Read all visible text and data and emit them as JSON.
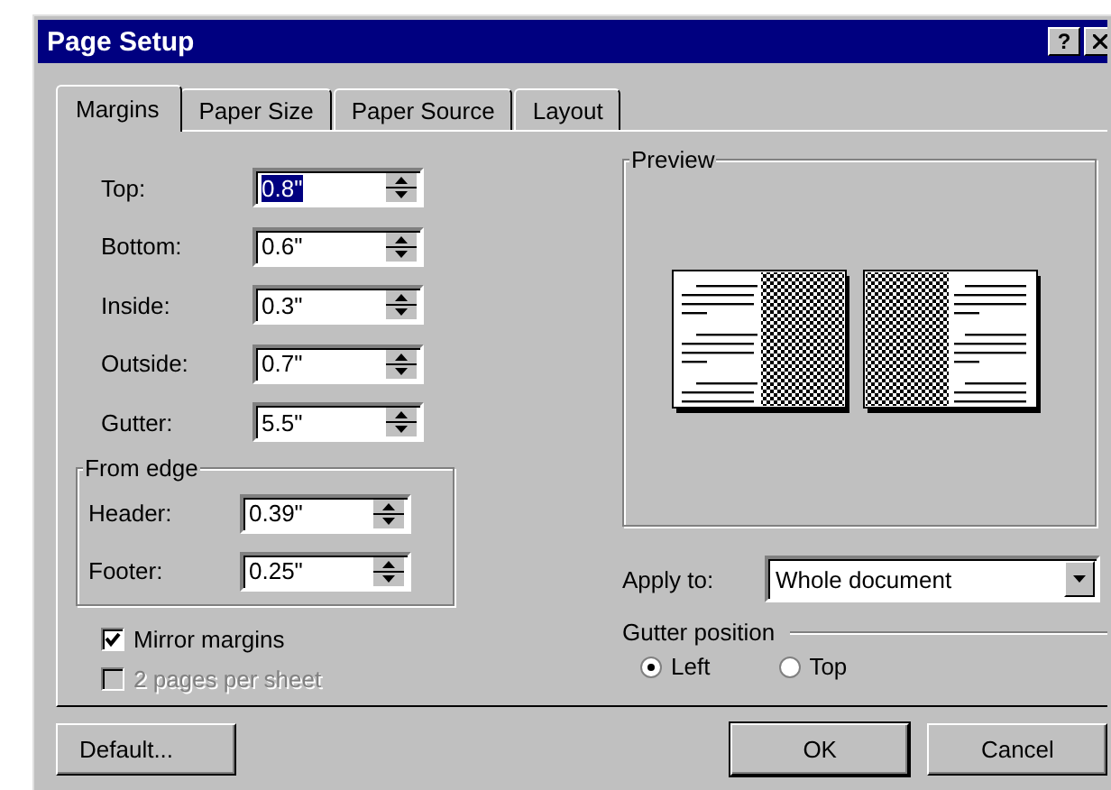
{
  "window": {
    "title": "Page Setup",
    "help": "?"
  },
  "tabs": [
    {
      "label": "Margins",
      "selected": true
    },
    {
      "label": "Paper Size",
      "selected": false
    },
    {
      "label": "Paper Source",
      "selected": false
    },
    {
      "label": "Layout",
      "selected": false
    }
  ],
  "margins": [
    {
      "label": "Top:",
      "value": "0.8\"",
      "focused": true
    },
    {
      "label": "Bottom:",
      "value": "0.6\"",
      "focused": false
    },
    {
      "label": "Inside:",
      "value": "0.3\"",
      "focused": false
    },
    {
      "label": "Outside:",
      "value": "0.7\"",
      "focused": false
    },
    {
      "label": "Gutter:",
      "value": "5.5\"",
      "focused": false
    }
  ],
  "from_edge": {
    "title": "From edge",
    "fields": [
      {
        "label": "Header:",
        "value": "0.39\"",
        "focused": false
      },
      {
        "label": "Footer:",
        "value": "0.25\"",
        "focused": false
      }
    ]
  },
  "checkboxes": [
    {
      "label": "Mirror margins",
      "checked": true,
      "disabled": false
    },
    {
      "label": "2 pages per sheet",
      "checked": false,
      "disabled": true
    }
  ],
  "preview": {
    "title": "Preview"
  },
  "apply_to": {
    "label": "Apply to:",
    "value": "Whole document"
  },
  "gutter_position": {
    "title": "Gutter position",
    "options": [
      {
        "label": "Left",
        "selected": true
      },
      {
        "label": "Top",
        "selected": false
      }
    ]
  },
  "buttons": {
    "default": "Default...",
    "ok": "OK",
    "cancel": "Cancel"
  }
}
